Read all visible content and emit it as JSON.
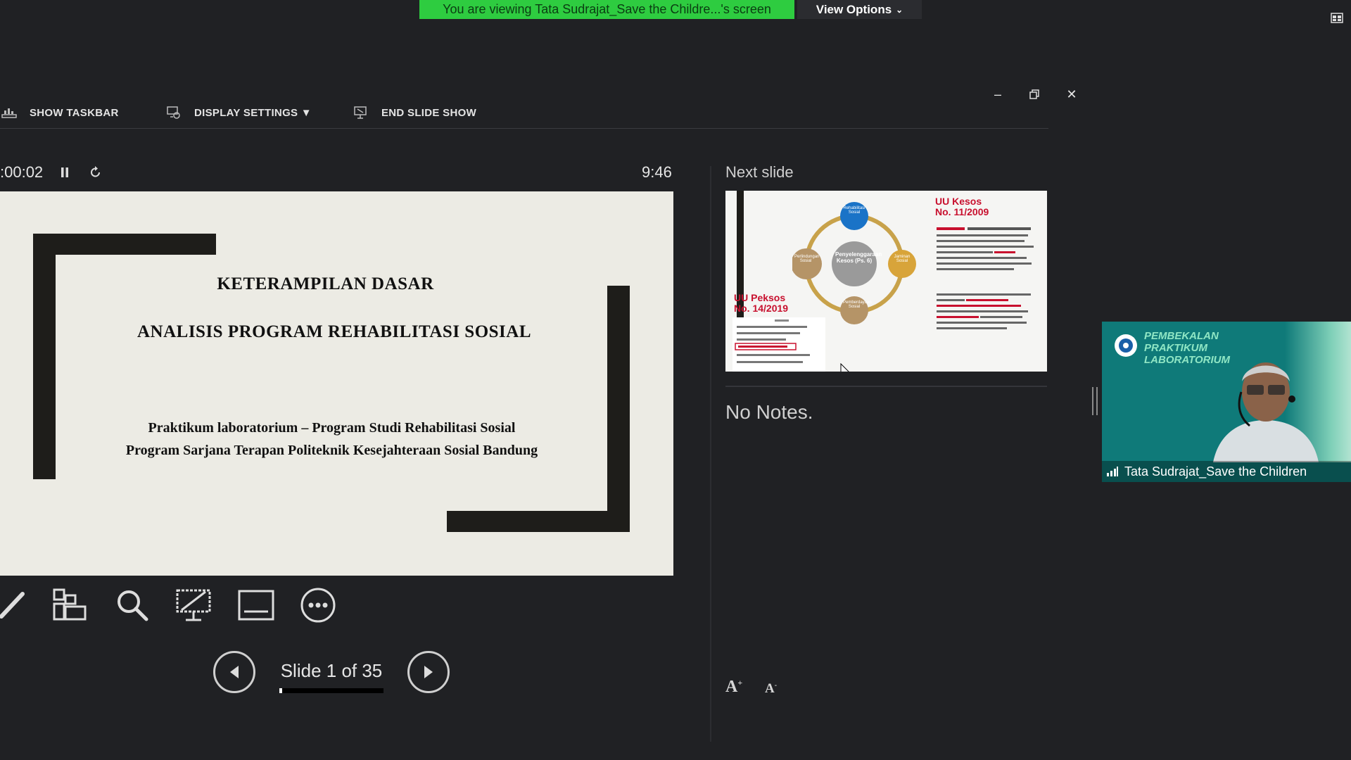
{
  "zoom": {
    "banner_text": "You are viewing Tata Sudrajat_Save the Childre...'s screen",
    "view_options_label": "View Options"
  },
  "toolbar": {
    "show_taskbar": "SHOW TASKBAR",
    "display_settings": "DISPLAY SETTINGS ▼",
    "end_slide_show": "END SLIDE SHOW"
  },
  "timer": {
    "elapsed": ":00:02",
    "clock": "9:46"
  },
  "current_slide": {
    "title_line1": "KETERAMPILAN DASAR",
    "title_line2": "ANALISIS PROGRAM REHABILITASI SOSIAL",
    "subtitle_line1": "Praktikum laboratorium – Program Studi Rehabilitasi Sosial",
    "subtitle_line2": "Program Sarjana Terapan Politeknik Kesejahteraan Sosial Bandung"
  },
  "navigation": {
    "slide_label": "Slide 1 of 35",
    "progress_fraction": 0.03
  },
  "next_slide": {
    "label": "Next slide",
    "heading_right": "UU Kesos\nNo. 11/2009",
    "heading_left": "UU Peksos\nNo. 14/2019",
    "center_text": "Penyelenggaraan Kesos (Ps. 6)",
    "node_top": "Rehabilitasi Sosial",
    "node_left": "Perlindungan Sosial",
    "node_right": "Jaminan Sosial",
    "node_bottom": "Pemberdayaan Sosial"
  },
  "notes": {
    "text": "No Notes."
  },
  "participant": {
    "name": "Tata Sudrajat_Save the Children",
    "banner_text": "PEMBEKALAN PRAKTIKUM LABORATORIUM"
  },
  "colors": {
    "banner_green": "#2ecc40",
    "background": "#202124",
    "slide_bg": "#ecebe4",
    "accent_red": "#c8102e",
    "video_teal": "#0f7a79"
  }
}
